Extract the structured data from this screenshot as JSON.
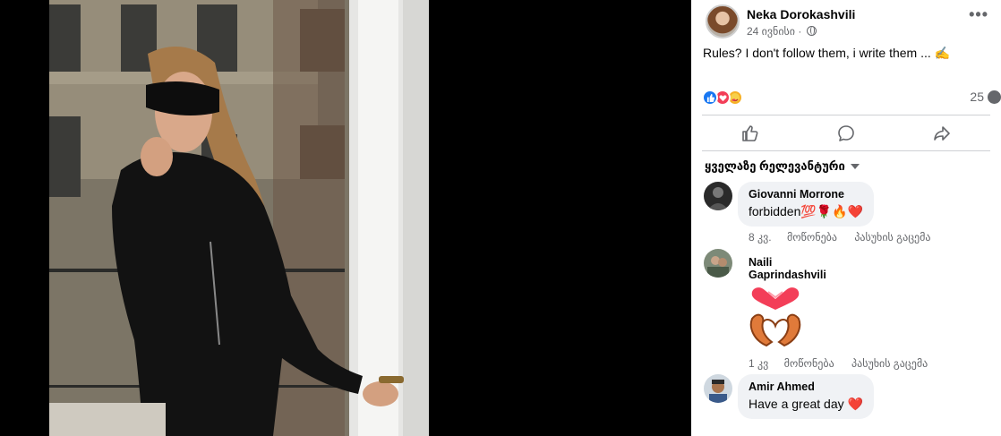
{
  "post": {
    "author": "Neka Dorokashvili",
    "date": "24 ივნისი",
    "separator": "·",
    "text": "Rules? I don't follow them, i write them ... ✍️",
    "comment_count": "25"
  },
  "actions": {
    "like_icon": "thumbs-up-icon",
    "comment_icon": "comment-bubble-icon",
    "share_icon": "share-arrow-icon"
  },
  "sort_label": "ყველაზე რელევანტური",
  "comments": [
    {
      "author": "Giovanni Morrone",
      "text": "forbidden💯🌹🔥❤️",
      "time": "8 კვ.",
      "like": "მოწონება",
      "reply": "პასუხის გაცემა"
    },
    {
      "author": "Naili Gaprindashvili",
      "sticker": "heart-hands-sticker",
      "time": "1 კვ",
      "like": "მოწონება",
      "reply": "პასუხის გაცემა"
    },
    {
      "author": "Amir Ahmed",
      "text": "Have a great day ❤️"
    }
  ],
  "colors": {
    "brand_blue": "#1877f2",
    "love_red": "#f33e58",
    "care_yellow": "#f7b125",
    "secondary_text": "#65676b",
    "bubble_bg": "#f0f2f5"
  }
}
